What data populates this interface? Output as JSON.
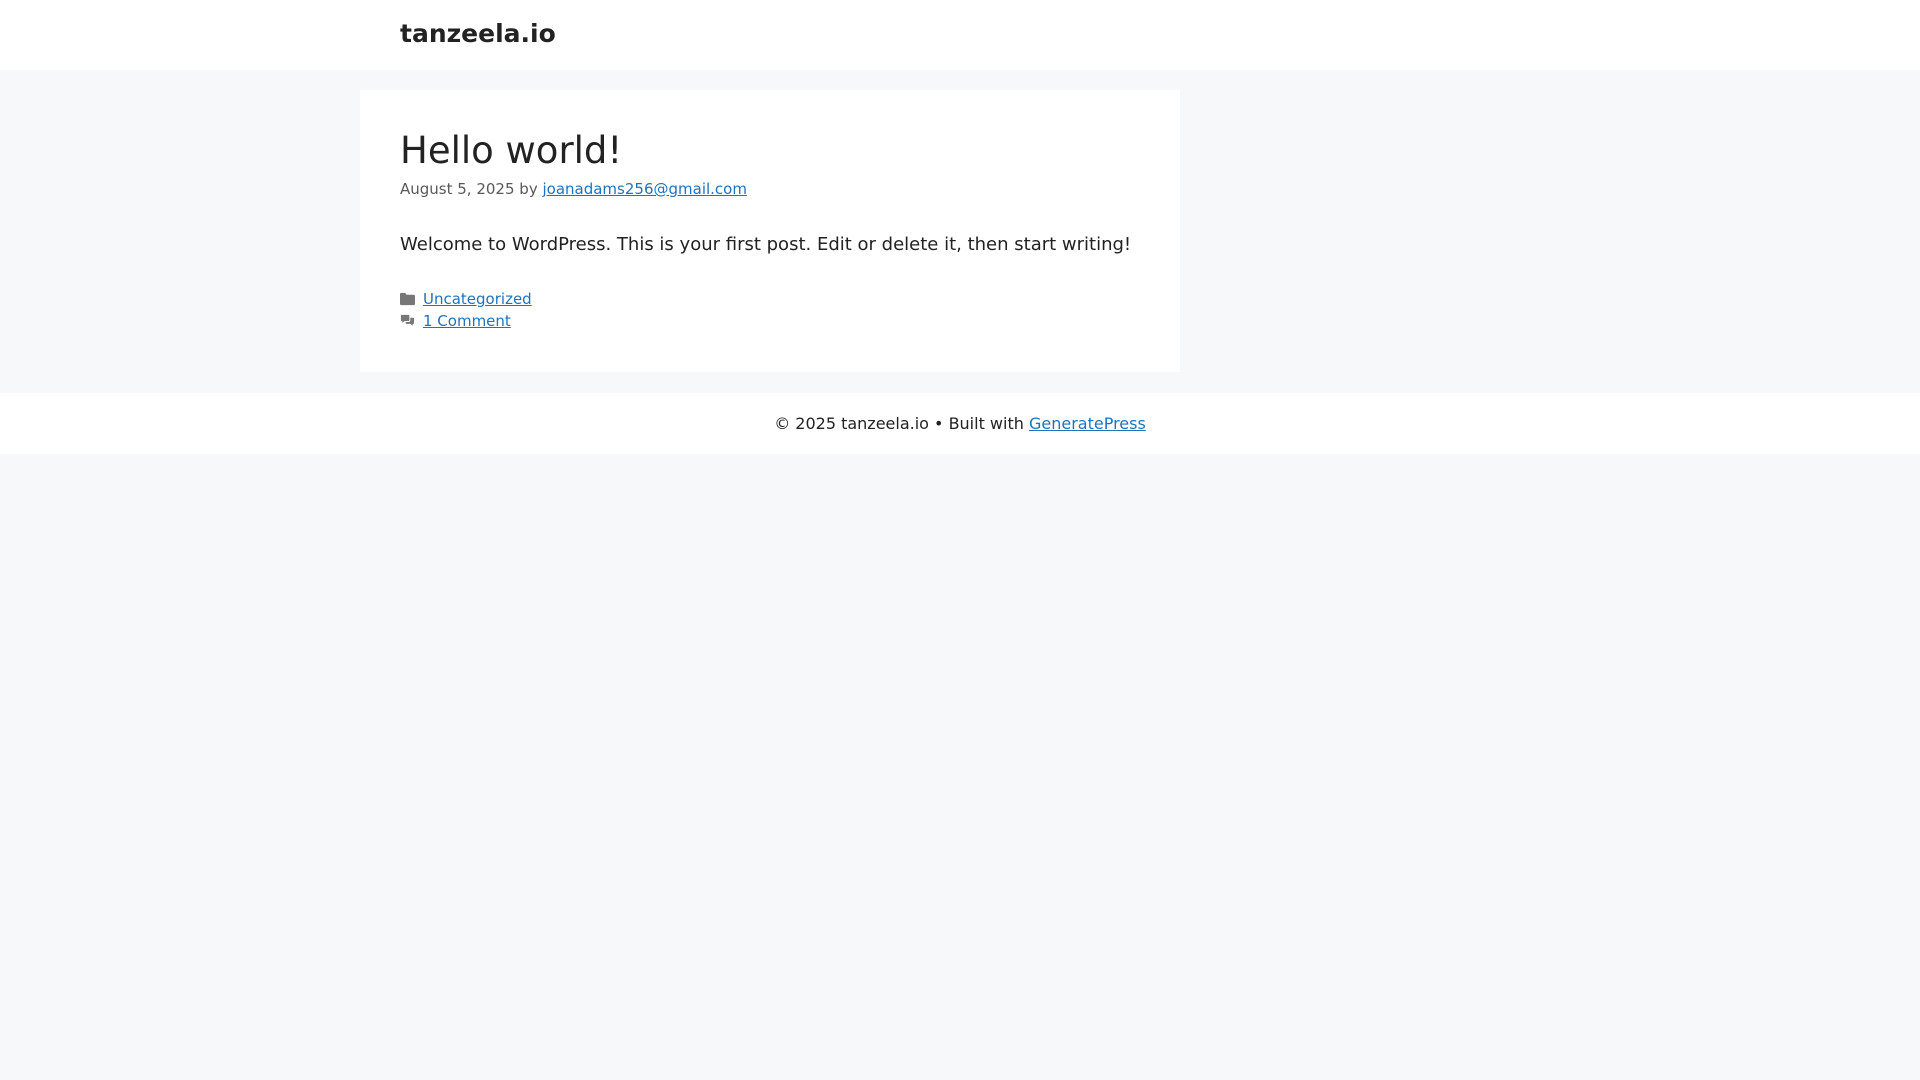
{
  "header": {
    "site_title": "tanzeela.io"
  },
  "post": {
    "title": "Hello world!",
    "date": "August 5, 2025",
    "by": "by",
    "author": "joanadams256@gmail.com",
    "content": "Welcome to WordPress. This is your first post. Edit or delete it, then start writing!",
    "category_icon": "folder-icon",
    "category": "Uncategorized",
    "comments_icon": "comments-icon",
    "comments": "1 Comment"
  },
  "footer": {
    "copyright": "© 2025 tanzeela.io • Built with",
    "link": "GeneratePress"
  },
  "colors": {
    "background": "#f7f8f9",
    "surface": "#ffffff",
    "link": "#1e73be",
    "text": "#222222",
    "muted": "#595959"
  }
}
